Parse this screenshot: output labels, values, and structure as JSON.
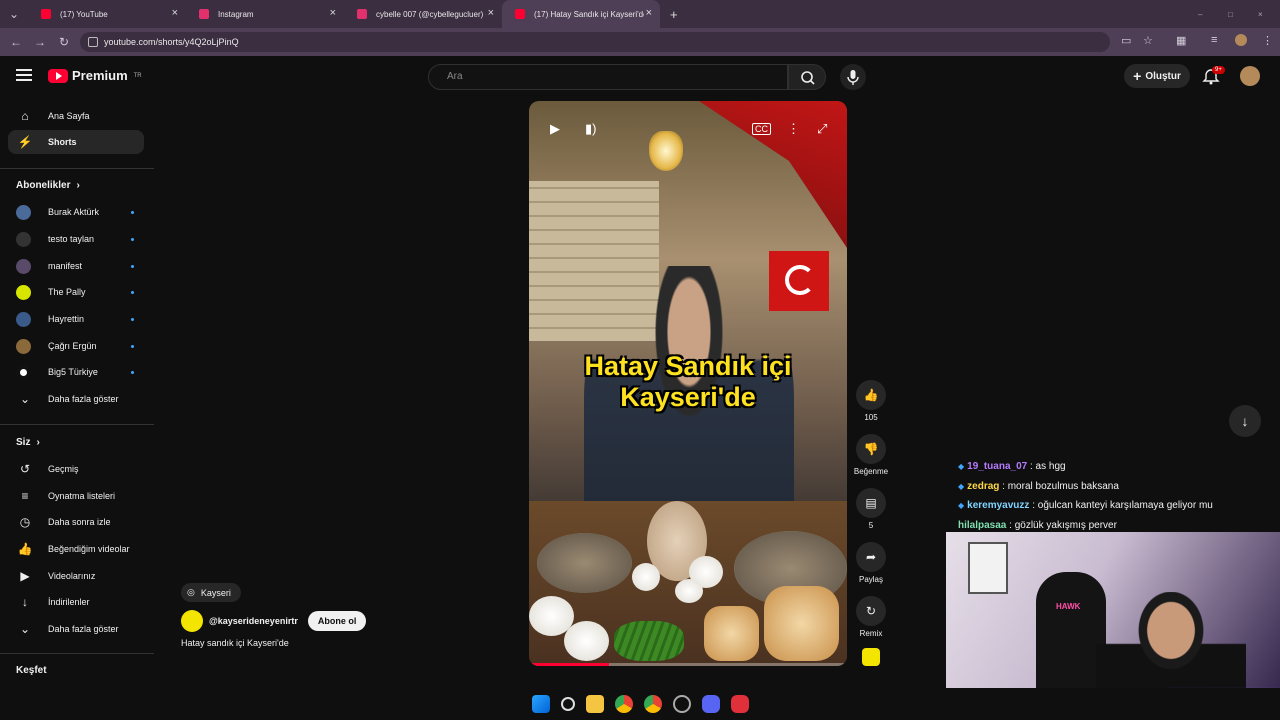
{
  "browser": {
    "tabs": [
      {
        "title": "(17) YouTube",
        "favicon_color": "#ff0033"
      },
      {
        "title": "Instagram",
        "favicon_color": "#e1306c"
      },
      {
        "title": "cybelle 007 (@cybellegucluer) •",
        "favicon_color": "#e1306c"
      },
      {
        "title": "(17) Hatay Sandık içi Kayseri'de",
        "favicon_color": "#ff0033"
      }
    ],
    "url": "youtube.com/shorts/y4Q2oLjPinQ"
  },
  "header": {
    "logo_text": "Premium",
    "region": "TR",
    "search_placeholder": "Ara",
    "create_label": "Oluştur",
    "notification_count": "9+"
  },
  "sidebar": {
    "main": [
      {
        "label": "Ana Sayfa",
        "icon": "home-icon"
      },
      {
        "label": "Shorts",
        "icon": "shorts-icon"
      }
    ],
    "subscriptions_header": "Abonelikler",
    "subscriptions": [
      {
        "label": "Burak Aktürk",
        "color": "#4a6a9a"
      },
      {
        "label": "testo taylan",
        "color": "#333333"
      },
      {
        "label": "manifest",
        "color": "#5a4a6a"
      },
      {
        "label": "The Pally",
        "color": "#d6e600"
      },
      {
        "label": "Hayrettin",
        "color": "#3a5a8a"
      },
      {
        "label": "Çağrı Ergün",
        "color": "#8a6a3a"
      },
      {
        "label": "Big5 Türkiye",
        "color": "#ffffff"
      }
    ],
    "show_more": "Daha fazla göster",
    "you_header": "Siz",
    "you_items": [
      {
        "label": "Geçmiş",
        "icon": "history-icon"
      },
      {
        "label": "Oynatma listeleri",
        "icon": "playlist-icon"
      },
      {
        "label": "Daha sonra izle",
        "icon": "clock-icon"
      },
      {
        "label": "Beğendiğim videolar",
        "icon": "like-icon"
      },
      {
        "label": "Videolarınız",
        "icon": "video-icon"
      },
      {
        "label": "İndirilenler",
        "icon": "download-icon"
      }
    ],
    "show_more_2": "Daha fazla göster",
    "explore_header": "Keşfet"
  },
  "short": {
    "caption_line1": "Hatay Sandık içi",
    "caption_line2": "Kayseri'de",
    "location": "Kayseri",
    "channel": "@kayserideneyenirtr",
    "subscribe_label": "Abone ol",
    "title": "Hatay sandık içi Kayseri'de",
    "progress": 0.25,
    "likes": "105",
    "dislike_label": "Beğenme",
    "comments": "5",
    "share_label": "Paylaş",
    "remix_label": "Remix"
  },
  "chat": [
    {
      "user": "19_tuana_07",
      "text": ": as hgg",
      "color": "#b57bff"
    },
    {
      "user": "zedrag",
      "text": ": moral bozulmus baksana",
      "color": "#ffd84a"
    },
    {
      "user": "keremyavuzz",
      "text": ": oğulcan kanteyi karşılamaya geliyor mu",
      "color": "#7fd4ff"
    },
    {
      "user": "hilalpasaa",
      "text": ": gözlük yakışmış perver",
      "color": "#7fe0b0"
    }
  ],
  "webcam": {
    "chair_brand": "HAWK"
  }
}
